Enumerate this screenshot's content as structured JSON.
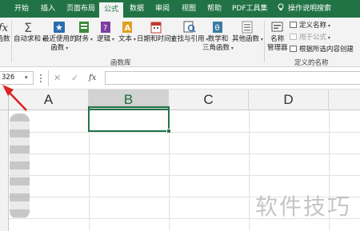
{
  "tabs": [
    {
      "label": "开始"
    },
    {
      "label": "插入"
    },
    {
      "label": "页面布局"
    },
    {
      "label": "公式",
      "active": true
    },
    {
      "label": "数据"
    },
    {
      "label": "审阅"
    },
    {
      "label": "视图"
    },
    {
      "label": "帮助"
    },
    {
      "label": "PDF工具集"
    },
    {
      "label": "操作说明搜索"
    }
  ],
  "ribbon": {
    "insert_function_label": "函数",
    "autosum_label": "自动求和",
    "recent_label_1": "最近使用的",
    "recent_label_2": "函数",
    "financial_label": "财务",
    "logical_label": "逻辑",
    "text_label": "文本",
    "datetime_label": "日期和时间",
    "lookup_label": "查找与引用",
    "math_label_1": "数学和",
    "math_label_2": "三角函数",
    "more_label": "其他函数",
    "library_group": "函数库",
    "name_manager_label_1": "名称",
    "name_manager_label_2": "管理器",
    "define_name_label": "定义名称",
    "use_in_formula_label": "用于公式",
    "create_from_selection_label": "根据所选内容创建",
    "names_group": "定义的名称"
  },
  "formula_bar": {
    "name_box_value": "326",
    "cancel_glyph": "✕",
    "enter_glyph": "✓",
    "fx_glyph": "fx",
    "formula_value": ""
  },
  "columns": [
    {
      "label": "A"
    },
    {
      "label": "B"
    },
    {
      "label": "C"
    },
    {
      "label": "D"
    }
  ],
  "selected_column": "B",
  "watermark": "软件技巧",
  "colors": {
    "accent": "#217346",
    "arrow": "#e02020"
  }
}
